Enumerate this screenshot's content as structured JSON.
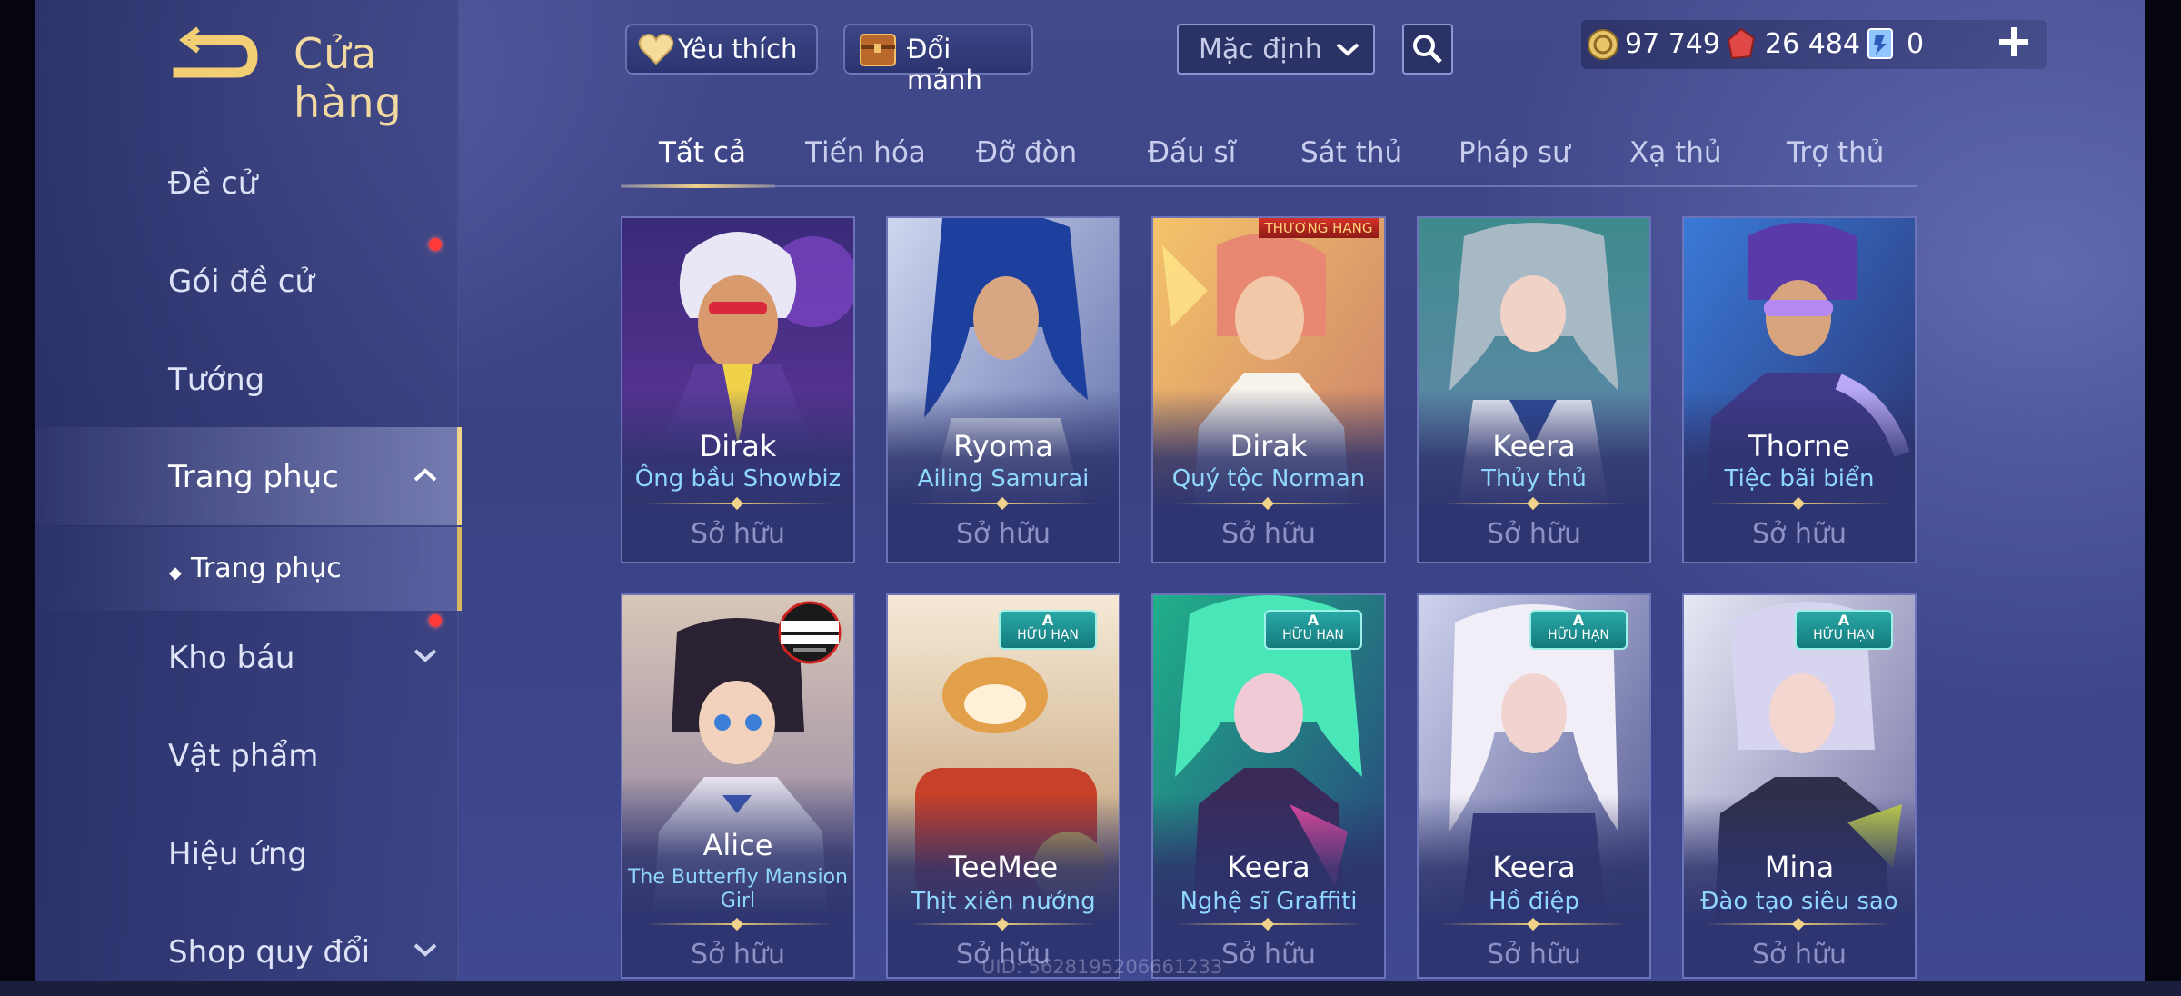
{
  "header": {
    "title": "Cửa hàng",
    "favorite_label": "Yêu thích",
    "exchange_label": "Đổi mảnh",
    "sort_value": "Mặc định"
  },
  "currency": {
    "gold": "97 749",
    "gems": "26 484",
    "vouchers": "0"
  },
  "sidebar": {
    "items": [
      {
        "label": "Đề cử"
      },
      {
        "label": "Gói đề cử"
      },
      {
        "label": "Tướng"
      },
      {
        "label": "Trang phục"
      },
      {
        "label": "Trang phục"
      },
      {
        "label": "Kho báu"
      },
      {
        "label": "Vật phẩm"
      },
      {
        "label": "Hiệu ứng"
      },
      {
        "label": "Shop quy đổi"
      }
    ]
  },
  "tabs": [
    "Tất cả",
    "Tiến hóa",
    "Đỡ đòn",
    "Đấu sĩ",
    "Sát thủ",
    "Pháp sư",
    "Xạ thủ",
    "Trợ thủ"
  ],
  "cards": [
    {
      "hero": "Dirak",
      "skin": "Ông bầu Showbiz",
      "status": "Sở hữu"
    },
    {
      "hero": "Ryoma",
      "skin": "Ailing Samurai",
      "status": "Sở hữu"
    },
    {
      "hero": "Dirak",
      "skin": "Quý tộc Norman",
      "status": "Sở hữu",
      "ribbon": "THƯỢNG HẠNG"
    },
    {
      "hero": "Keera",
      "skin": "Thủy thủ",
      "status": "Sở hữu"
    },
    {
      "hero": "Thorne",
      "skin": "Tiệc bãi biển",
      "status": "Sở hữu"
    },
    {
      "hero": "Alice",
      "skin": "The Butterfly Mansion Girl",
      "status": "Sở hữu"
    },
    {
      "hero": "TeeMee",
      "skin": "Thịt xiên nướng",
      "status": "Sở hữu",
      "badge_rank": "A",
      "badge_text": "HỮU HẠN"
    },
    {
      "hero": "Keera",
      "skin": "Nghệ sĩ Graffiti",
      "status": "Sở hữu",
      "badge_rank": "A",
      "badge_text": "HỮU HẠN"
    },
    {
      "hero": "Keera",
      "skin": "Hồ điệp",
      "status": "Sở hữu",
      "badge_rank": "A",
      "badge_text": "HỮU HẠN"
    },
    {
      "hero": "Mina",
      "skin": "Đào tạo siêu sao",
      "status": "Sở hữu",
      "badge_rank": "A",
      "badge_text": "HỮU HẠN"
    }
  ],
  "footer": {
    "uid": "UID: 5628195206661233"
  },
  "colors": {
    "accent_gold": "#f0d28a",
    "skin_blue": "#8fd7ff",
    "owned_gray": "#8c92c6",
    "badge_teal": "#2aa8a6"
  }
}
